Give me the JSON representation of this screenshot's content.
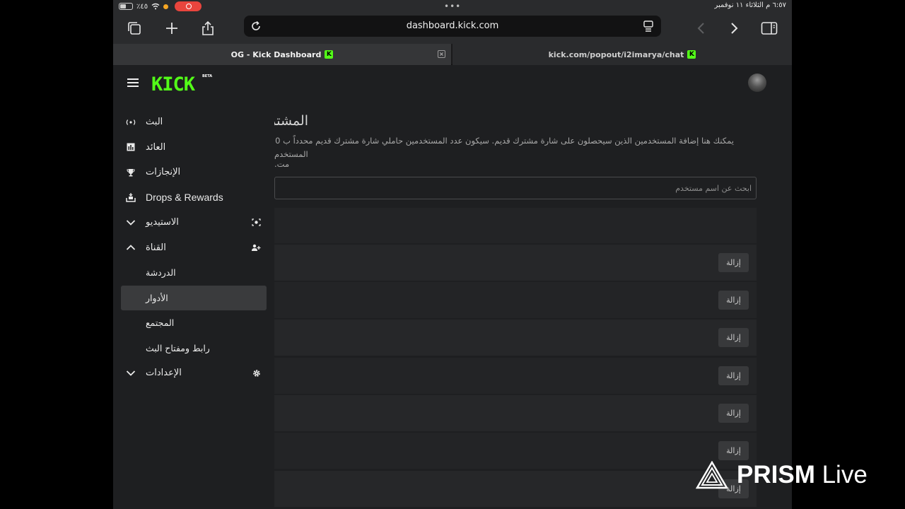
{
  "status_bar": {
    "battery": "٪٤٥",
    "datetime": "٦:٥٧ م  الثلاثاء ١١ نوفمبر"
  },
  "browser": {
    "url": "dashboard.kick.com",
    "tabs": [
      {
        "title": "OG - Kick Dashboard",
        "active": true
      },
      {
        "title": "kick.com/popout/i2imarya/chat",
        "active": false
      }
    ],
    "favicon_letter": "K"
  },
  "app": {
    "logo_text": "KICK",
    "beta_label": "BETA",
    "brand_color": "#53fc18"
  },
  "sidebar": {
    "items": [
      {
        "label": "البث",
        "icon": "broadcast-icon"
      },
      {
        "label": "العائد",
        "icon": "revenue-chart-icon"
      },
      {
        "label": "الإنجازات",
        "icon": "trophy-icon"
      },
      {
        "label": "Drops & Rewards",
        "icon": "drops-gift-icon"
      },
      {
        "label": "الاستيديو",
        "icon": "studio-camera-icon",
        "expanded": false
      },
      {
        "label": "القناة",
        "icon": "channel-users-icon",
        "expanded": true
      },
      {
        "label": "الدردشة",
        "sub": true
      },
      {
        "label": "الأدوار",
        "sub": true,
        "selected": true
      },
      {
        "label": "المجتمع",
        "sub": true
      },
      {
        "label": "رابط ومفتاح البث",
        "sub": true
      },
      {
        "label": "الإعدادات",
        "icon": "settings-gear-icon",
        "expanded": false
      }
    ]
  },
  "content": {
    "title": "المشتر",
    "description_line1": "يمكنك هنا إضافة المستخدمين الذين سيحصلون على شارة مشترك قديم. سيكون عدد المستخدمين حاملي شارة مشترك قديم محدداً ب 0",
    "description_line2": "المستخدم مت.",
    "search_placeholder": "ابحث عن اسم مستخدم",
    "remove_label": "إزالة",
    "row_count": 7
  },
  "watermark": {
    "brand": "PRISM",
    "suffix": "Live"
  }
}
